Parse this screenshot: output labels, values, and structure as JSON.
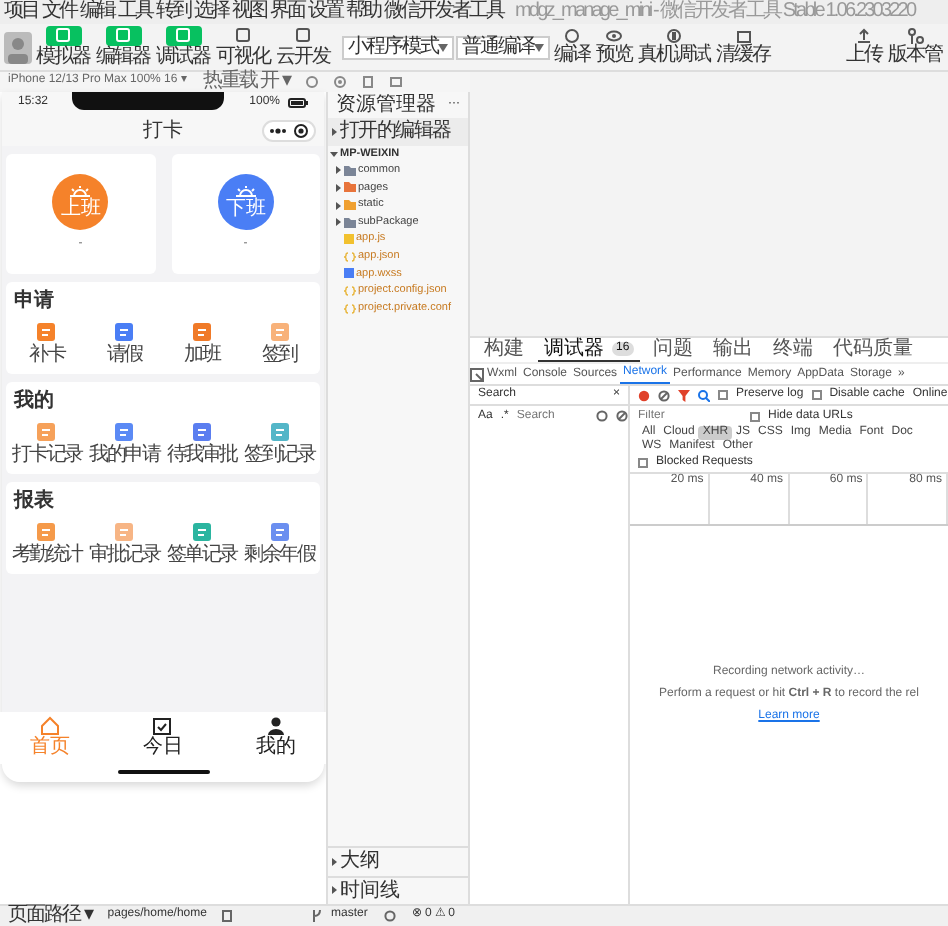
{
  "menu": [
    "项目",
    "文件",
    "编辑",
    "工具",
    "转到",
    "选择",
    "视图",
    "界面",
    "设置",
    "帮助",
    "微信开发者工具"
  ],
  "window": {
    "title": "mdgz_manage_mini - 微信开发者工具 Stable 1.06.2303220"
  },
  "toolbar": {
    "mode_buttons": [
      {
        "label": "模拟器",
        "selected": true
      },
      {
        "label": "编辑器",
        "selected": true
      },
      {
        "label": "调试器",
        "selected": true
      },
      {
        "label": "可视化",
        "selected": false
      },
      {
        "label": "云开发",
        "selected": false
      }
    ],
    "mode_select": "小程序模式",
    "compile_select": "普通编译",
    "actions": [
      "编译",
      "预览",
      "真机调试",
      "清缓存"
    ],
    "right_actions": [
      "上传",
      "版本管"
    ]
  },
  "simulator_bar": {
    "device": "iPhone 12/13 Pro Max 100% 16 ▾",
    "hot_reload": "热重载 开 ▾"
  },
  "phone": {
    "time": "15:32",
    "battery": "100%",
    "title": "打卡",
    "punch_cards": [
      {
        "label": "上班",
        "color": "#f5822a",
        "time": "-"
      },
      {
        "label": "下班",
        "color": "#4a7ef5",
        "time": "-"
      }
    ],
    "sections": [
      {
        "title": "申请",
        "items": [
          {
            "label": "补卡",
            "color": "#f5822a"
          },
          {
            "label": "请假",
            "color": "#4a7ef5"
          },
          {
            "label": "加班",
            "color": "#f07a28"
          },
          {
            "label": "签到",
            "color": "#f8b27a"
          }
        ]
      },
      {
        "title": "我的",
        "items": [
          {
            "label": "打卡记录",
            "color": "#f6a15a"
          },
          {
            "label": "我的申请",
            "color": "#5b8af5"
          },
          {
            "label": "待我审批",
            "color": "#5b7ef0"
          },
          {
            "label": "签到记录",
            "color": "#53b6c8"
          }
        ]
      },
      {
        "title": "报表",
        "items": [
          {
            "label": "考勤统计",
            "color": "#f59a4a"
          },
          {
            "label": "审批记录",
            "color": "#f7b585"
          },
          {
            "label": "签单记录",
            "color": "#2bb5a0"
          },
          {
            "label": "剩余年假",
            "color": "#6b8ff0"
          }
        ]
      }
    ],
    "tabs": [
      {
        "label": "首页",
        "kind": "home",
        "selected": true
      },
      {
        "label": "今日",
        "kind": "calendar",
        "selected": false
      },
      {
        "label": "我的",
        "kind": "person",
        "selected": false
      }
    ]
  },
  "explorer": {
    "title": "资源管理器",
    "more": "···",
    "open_editors": "打开的编辑器",
    "project": "MP-WEIXIN",
    "items": [
      {
        "name": "common",
        "kind": "folder",
        "color": "#7b8597",
        "expanded": false
      },
      {
        "name": "pages",
        "kind": "folder",
        "color": "#e8743b",
        "expanded": false
      },
      {
        "name": "static",
        "kind": "folder",
        "color": "#f0a030",
        "expanded": false
      },
      {
        "name": "subPackage",
        "kind": "folder",
        "color": "#7b8597",
        "expanded": false
      },
      {
        "name": "app.js",
        "kind": "js"
      },
      {
        "name": "app.json",
        "kind": "json"
      },
      {
        "name": "app.wxss",
        "kind": "wxss"
      },
      {
        "name": "project.config.json",
        "kind": "json"
      },
      {
        "name": "project.private.conf",
        "kind": "json"
      }
    ],
    "outline": "大纲",
    "timeline": "时间线"
  },
  "devtools": {
    "panel_tabs": [
      {
        "label": "构建",
        "selected": false
      },
      {
        "label": "调试器",
        "selected": true,
        "badge": "16"
      },
      {
        "label": "问题",
        "selected": false
      },
      {
        "label": "输出",
        "selected": false
      },
      {
        "label": "终端",
        "selected": false
      },
      {
        "label": "代码质量",
        "selected": false
      }
    ],
    "tabs": [
      {
        "label": "Wxml",
        "selected": false
      },
      {
        "label": "Console",
        "selected": false
      },
      {
        "label": "Sources",
        "selected": false
      },
      {
        "label": "Network",
        "selected": true
      },
      {
        "label": "Performance",
        "selected": false
      },
      {
        "label": "Memory",
        "selected": false
      },
      {
        "label": "AppData",
        "selected": false
      },
      {
        "label": "Storage",
        "selected": false
      },
      {
        "label": "»",
        "selected": false
      }
    ],
    "search": {
      "title": "Search",
      "close": "×",
      "case": "Aa",
      "regex": ".*",
      "placeholder": "Search"
    },
    "network": {
      "preserve_log": {
        "label": "Preserve log",
        "checked": false
      },
      "disable_cache": {
        "label": "Disable cache",
        "checked": false
      },
      "throttle": "Online",
      "filter_placeholder": "Filter",
      "hide_data_urls": {
        "label": "Hide data URLs",
        "checked": false
      },
      "types": [
        {
          "label": "All",
          "selected": false
        },
        {
          "label": "Cloud",
          "selected": false
        },
        {
          "label": "XHR",
          "selected": true
        },
        {
          "label": "JS",
          "selected": false
        },
        {
          "label": "CSS",
          "selected": false
        },
        {
          "label": "Img",
          "selected": false
        },
        {
          "label": "Media",
          "selected": false
        },
        {
          "label": "Font",
          "selected": false
        },
        {
          "label": "Doc",
          "selected": false
        },
        {
          "label": "WS",
          "selected": false
        },
        {
          "label": "Manifest",
          "selected": false
        },
        {
          "label": "Other",
          "selected": false
        }
      ],
      "blocked_requests": {
        "label": "Blocked Requests",
        "checked": false
      },
      "ticks": [
        "20 ms",
        "40 ms",
        "60 ms",
        "80 ms"
      ],
      "empty_title": "Recording network activity…",
      "empty_hint": "Perform a request or hit **Ctrl + R** to record the rel",
      "learn_more": "Learn more"
    }
  },
  "status_bar": {
    "page_path": "页面路径 ▾",
    "path": "pages/home/home",
    "branch": "master",
    "problems": "⊗ 0 ⚠ 0"
  }
}
